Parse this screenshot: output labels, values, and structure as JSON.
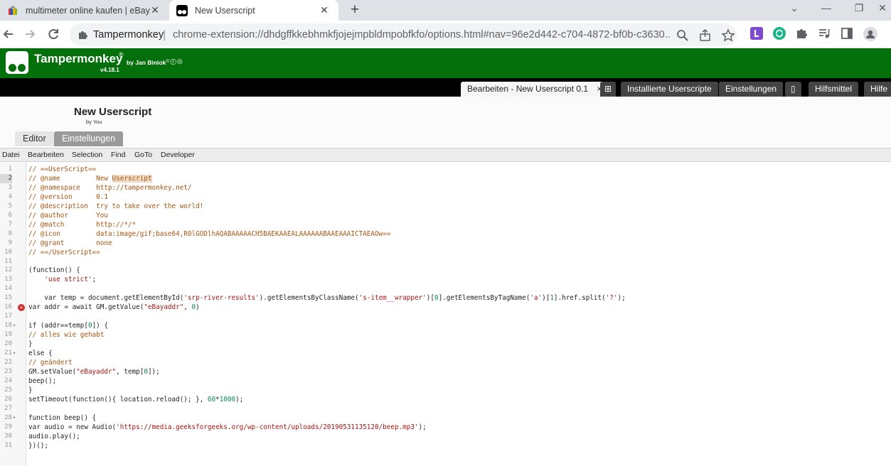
{
  "browser": {
    "tabs": [
      {
        "title": "multimeter online kaufen | eBay",
        "close": "✕"
      },
      {
        "title": "New Userscript",
        "close": "✕"
      }
    ],
    "new_tab": "+",
    "window_controls": {
      "minimize": "—",
      "restore": "❐",
      "close": "✕",
      "list": "⌄"
    },
    "address": {
      "site": "Tampermonkey",
      "separator": "|",
      "url": "chrome-extension://dhdgffkkebhmkfjojejmpbldmpobfkfo/options.html#nav=96e2d442-c704-4872-bf0b-c3630..."
    }
  },
  "tm": {
    "title": "Tampermonkey",
    "reg": "®",
    "version": "v4.18.1",
    "by": "by Jan Biniok",
    "social": "⌾ⓕ◎",
    "tabs": [
      {
        "label": "Bearbeiten - New Userscript 0.1",
        "close": "×"
      },
      {
        "label": "⊞"
      },
      {
        "label": "Installierte Userscripte"
      },
      {
        "label": "Einstellungen"
      },
      {
        "label": "▯"
      },
      {
        "label": "Hilfsmittel"
      },
      {
        "label": "Hilfe"
      }
    ],
    "script_name": "New Userscript",
    "script_by": "by You",
    "subtabs": [
      "Editor",
      "Einstellungen"
    ],
    "menu": [
      "Datei",
      "Bearbeiten",
      "Selection",
      "Find",
      "GoTo",
      "Developer"
    ]
  },
  "editor": {
    "current_line": 2,
    "error_line": 16,
    "fold_lines": [
      18,
      21,
      28
    ],
    "lines": [
      "// ==UserScript==",
      "// @name         New Userscript",
      "// @namespace    http://tampermonkey.net/",
      "// @version      0.1",
      "// @description  try to take over the world!",
      "// @author       You",
      "// @match        http://*/*",
      "// @icon         data:image/gif;base64,R0lGODlhAQABAAAAACH5BAEKAAEALAAAAAABAAEAAAICTAEAOw==",
      "// @grant        none",
      "// ==/UserScript==",
      "",
      "(function() {",
      "    'use strict';",
      "",
      "    var temp = document.getElementById('srp-river-results').getElementsByClassName('s-item__wrapper')[0].getElementsByTagName('a')[1].href.split('?');",
      "var addr = await GM.getValue(\"eBayaddr\", 0)",
      "",
      "if (addr==temp[0]) {",
      "// alles wie gehabt",
      "}",
      "else {",
      "// geändert",
      "GM.setValue(\"eBayaddr\", temp[0]);",
      "beep();",
      "}",
      "setTimeout(function(){ location.reload(); }, 60*1000);",
      "",
      "function beep() {",
      "var audio = new Audio('https://media.geeksforgeeks.org/wp-content/uploads/20190531135120/beep.mp3');",
      "audio.play();",
      "})();"
    ]
  }
}
